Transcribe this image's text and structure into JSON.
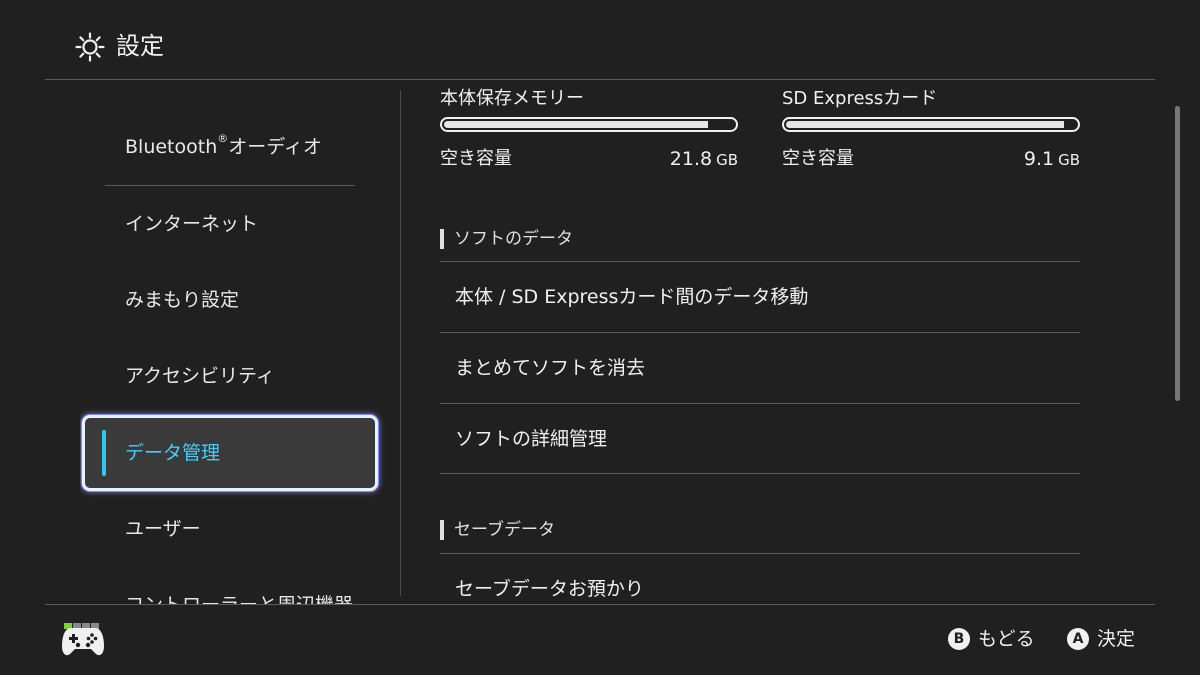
{
  "header": {
    "title": "設定",
    "icon": "gear-icon"
  },
  "sidebar": {
    "items": [
      {
        "label": "Bluetooth",
        "sup": "®",
        "label_suffix": "オーディオ"
      },
      {
        "label": "インターネット"
      },
      {
        "label": "みまもり設定"
      },
      {
        "label": "アクセシビリティ"
      },
      {
        "label": "データ管理",
        "selected": true
      },
      {
        "label": "ユーザー"
      },
      {
        "label": "コントローラーと周辺機器"
      }
    ]
  },
  "storage": {
    "internal": {
      "title": "本体保存メモリー",
      "free_label": "空き容量",
      "free_value": "21.8",
      "unit": "GB",
      "used_fraction": 0.91
    },
    "card": {
      "title": "SD Expressカード",
      "free_label": "空き容量",
      "free_value": "9.1",
      "unit": "GB",
      "used_fraction": 0.96
    }
  },
  "sections": {
    "software": {
      "heading": "ソフトのデータ",
      "items": [
        "本体 / SD Expressカード間のデータ移動",
        "まとめてソフトを消去",
        "ソフトの詳細管理"
      ]
    },
    "save": {
      "heading": "セーブデータ",
      "items": [
        "セーブデータお預かり"
      ]
    }
  },
  "footer": {
    "back": {
      "button": "B",
      "label": "もどる"
    },
    "confirm": {
      "button": "A",
      "label": "決定"
    },
    "player_indicator": {
      "active": 1,
      "total": 4
    }
  },
  "colors": {
    "background": "#202020",
    "accent": "#3fd0ff",
    "player_on": "#7ad33a"
  }
}
